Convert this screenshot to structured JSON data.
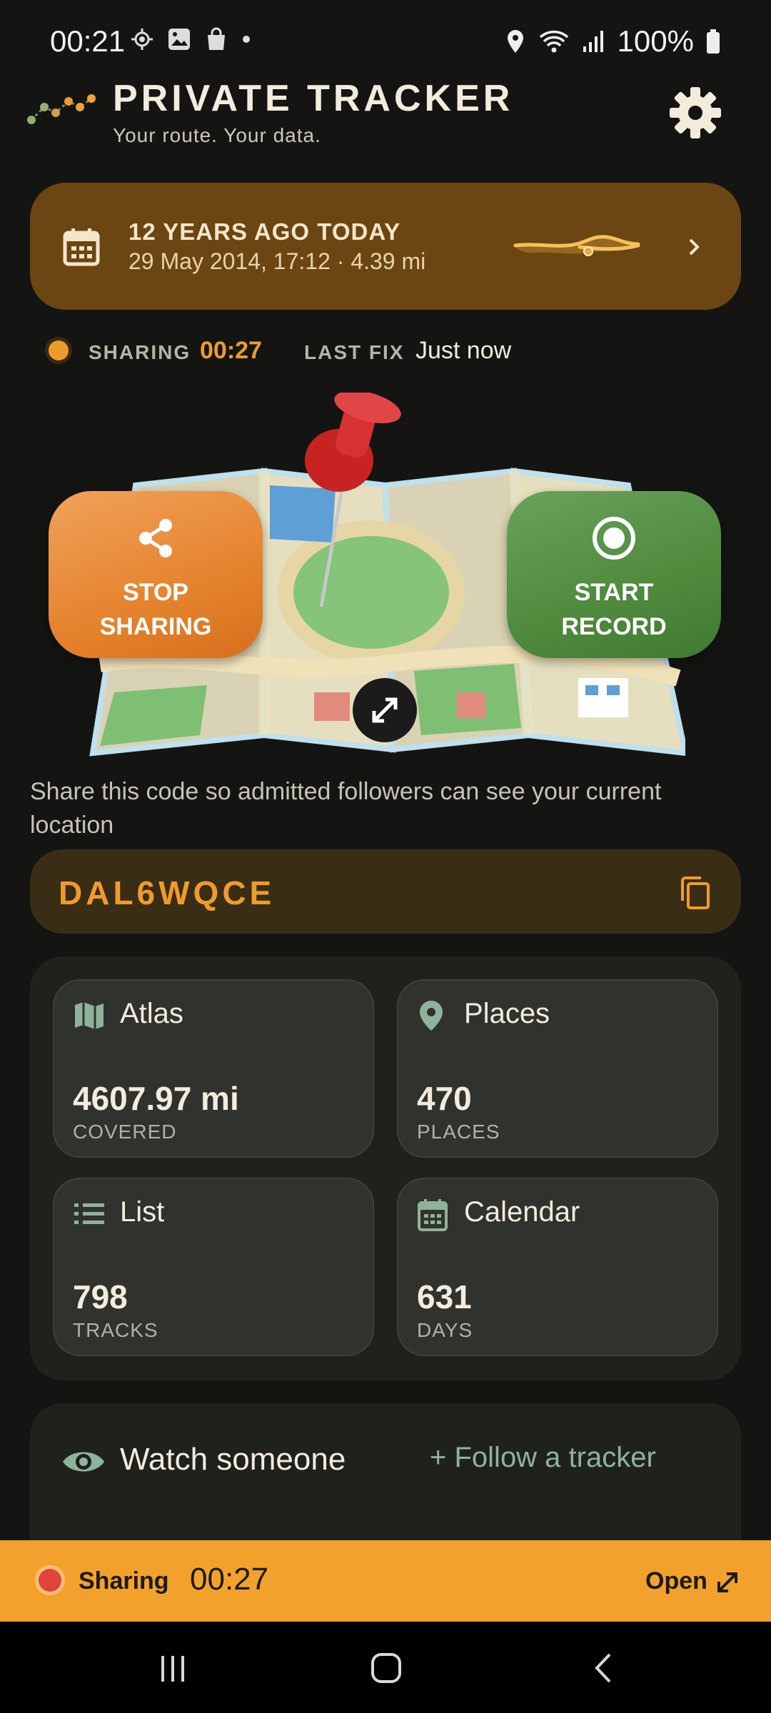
{
  "status_bar": {
    "time": "00:21",
    "battery": "100%"
  },
  "header": {
    "title": "PRIVATE TRACKER",
    "tagline": "Your route. Your data."
  },
  "memory": {
    "title": "12 YEARS AGO TODAY",
    "subtitle": "29 May 2014, 17:12 · 4.39 mi"
  },
  "sharing_status": {
    "sharing_label": "SHARING",
    "sharing_time": "00:27",
    "last_fix_label": "LAST FIX",
    "last_fix_value": "Just now"
  },
  "actions": {
    "stop_line1": "STOP",
    "stop_line2": "SHARING",
    "start_line1": "START",
    "start_line2": "RECORD"
  },
  "share_code": {
    "description": "Share this code so admitted followers can see your current location",
    "code": "DAL6WQCE"
  },
  "stats": {
    "atlas": {
      "title": "Atlas",
      "value": "4607.97 mi",
      "unit": "COVERED"
    },
    "places": {
      "title": "Places",
      "value": "470",
      "unit": "PLACES"
    },
    "list": {
      "title": "List",
      "value": "798",
      "unit": "TRACKS"
    },
    "calendar": {
      "title": "Calendar",
      "value": "631",
      "unit": "DAYS"
    }
  },
  "watch": {
    "title": "Watch someone",
    "follow_label": "Follow a tracker"
  },
  "sharing_bar": {
    "label": "Sharing",
    "time": "00:27",
    "open_label": "Open"
  },
  "colors": {
    "accent": "#ef9b2b",
    "green": "#4f8a3d",
    "background": "#141512"
  }
}
